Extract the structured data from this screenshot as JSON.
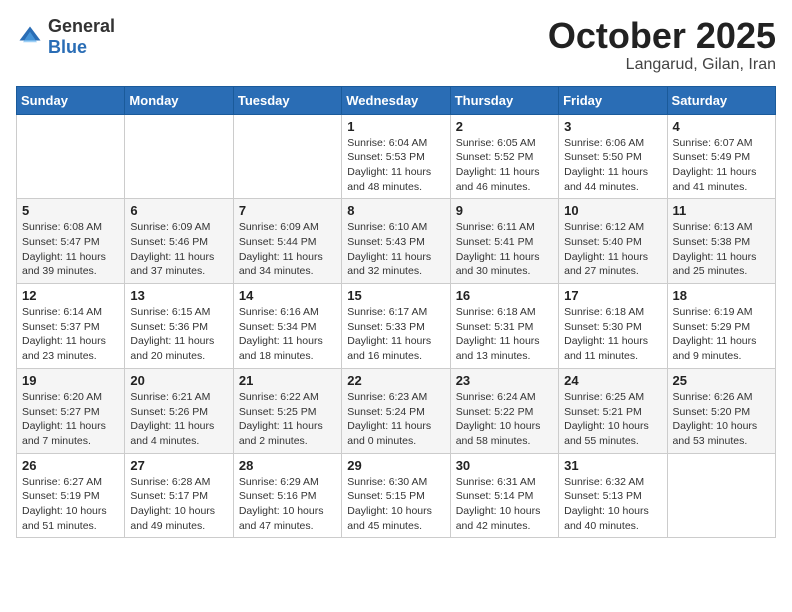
{
  "header": {
    "logo_general": "General",
    "logo_blue": "Blue",
    "month": "October 2025",
    "location": "Langarud, Gilan, Iran"
  },
  "weekdays": [
    "Sunday",
    "Monday",
    "Tuesday",
    "Wednesday",
    "Thursday",
    "Friday",
    "Saturday"
  ],
  "rows": [
    [
      {
        "day": "",
        "sunrise": "",
        "sunset": "",
        "daylight": ""
      },
      {
        "day": "",
        "sunrise": "",
        "sunset": "",
        "daylight": ""
      },
      {
        "day": "",
        "sunrise": "",
        "sunset": "",
        "daylight": ""
      },
      {
        "day": "1",
        "sunrise": "Sunrise: 6:04 AM",
        "sunset": "Sunset: 5:53 PM",
        "daylight": "Daylight: 11 hours and 48 minutes."
      },
      {
        "day": "2",
        "sunrise": "Sunrise: 6:05 AM",
        "sunset": "Sunset: 5:52 PM",
        "daylight": "Daylight: 11 hours and 46 minutes."
      },
      {
        "day": "3",
        "sunrise": "Sunrise: 6:06 AM",
        "sunset": "Sunset: 5:50 PM",
        "daylight": "Daylight: 11 hours and 44 minutes."
      },
      {
        "day": "4",
        "sunrise": "Sunrise: 6:07 AM",
        "sunset": "Sunset: 5:49 PM",
        "daylight": "Daylight: 11 hours and 41 minutes."
      }
    ],
    [
      {
        "day": "5",
        "sunrise": "Sunrise: 6:08 AM",
        "sunset": "Sunset: 5:47 PM",
        "daylight": "Daylight: 11 hours and 39 minutes."
      },
      {
        "day": "6",
        "sunrise": "Sunrise: 6:09 AM",
        "sunset": "Sunset: 5:46 PM",
        "daylight": "Daylight: 11 hours and 37 minutes."
      },
      {
        "day": "7",
        "sunrise": "Sunrise: 6:09 AM",
        "sunset": "Sunset: 5:44 PM",
        "daylight": "Daylight: 11 hours and 34 minutes."
      },
      {
        "day": "8",
        "sunrise": "Sunrise: 6:10 AM",
        "sunset": "Sunset: 5:43 PM",
        "daylight": "Daylight: 11 hours and 32 minutes."
      },
      {
        "day": "9",
        "sunrise": "Sunrise: 6:11 AM",
        "sunset": "Sunset: 5:41 PM",
        "daylight": "Daylight: 11 hours and 30 minutes."
      },
      {
        "day": "10",
        "sunrise": "Sunrise: 6:12 AM",
        "sunset": "Sunset: 5:40 PM",
        "daylight": "Daylight: 11 hours and 27 minutes."
      },
      {
        "day": "11",
        "sunrise": "Sunrise: 6:13 AM",
        "sunset": "Sunset: 5:38 PM",
        "daylight": "Daylight: 11 hours and 25 minutes."
      }
    ],
    [
      {
        "day": "12",
        "sunrise": "Sunrise: 6:14 AM",
        "sunset": "Sunset: 5:37 PM",
        "daylight": "Daylight: 11 hours and 23 minutes."
      },
      {
        "day": "13",
        "sunrise": "Sunrise: 6:15 AM",
        "sunset": "Sunset: 5:36 PM",
        "daylight": "Daylight: 11 hours and 20 minutes."
      },
      {
        "day": "14",
        "sunrise": "Sunrise: 6:16 AM",
        "sunset": "Sunset: 5:34 PM",
        "daylight": "Daylight: 11 hours and 18 minutes."
      },
      {
        "day": "15",
        "sunrise": "Sunrise: 6:17 AM",
        "sunset": "Sunset: 5:33 PM",
        "daylight": "Daylight: 11 hours and 16 minutes."
      },
      {
        "day": "16",
        "sunrise": "Sunrise: 6:18 AM",
        "sunset": "Sunset: 5:31 PM",
        "daylight": "Daylight: 11 hours and 13 minutes."
      },
      {
        "day": "17",
        "sunrise": "Sunrise: 6:18 AM",
        "sunset": "Sunset: 5:30 PM",
        "daylight": "Daylight: 11 hours and 11 minutes."
      },
      {
        "day": "18",
        "sunrise": "Sunrise: 6:19 AM",
        "sunset": "Sunset: 5:29 PM",
        "daylight": "Daylight: 11 hours and 9 minutes."
      }
    ],
    [
      {
        "day": "19",
        "sunrise": "Sunrise: 6:20 AM",
        "sunset": "Sunset: 5:27 PM",
        "daylight": "Daylight: 11 hours and 7 minutes."
      },
      {
        "day": "20",
        "sunrise": "Sunrise: 6:21 AM",
        "sunset": "Sunset: 5:26 PM",
        "daylight": "Daylight: 11 hours and 4 minutes."
      },
      {
        "day": "21",
        "sunrise": "Sunrise: 6:22 AM",
        "sunset": "Sunset: 5:25 PM",
        "daylight": "Daylight: 11 hours and 2 minutes."
      },
      {
        "day": "22",
        "sunrise": "Sunrise: 6:23 AM",
        "sunset": "Sunset: 5:24 PM",
        "daylight": "Daylight: 11 hours and 0 minutes."
      },
      {
        "day": "23",
        "sunrise": "Sunrise: 6:24 AM",
        "sunset": "Sunset: 5:22 PM",
        "daylight": "Daylight: 10 hours and 58 minutes."
      },
      {
        "day": "24",
        "sunrise": "Sunrise: 6:25 AM",
        "sunset": "Sunset: 5:21 PM",
        "daylight": "Daylight: 10 hours and 55 minutes."
      },
      {
        "day": "25",
        "sunrise": "Sunrise: 6:26 AM",
        "sunset": "Sunset: 5:20 PM",
        "daylight": "Daylight: 10 hours and 53 minutes."
      }
    ],
    [
      {
        "day": "26",
        "sunrise": "Sunrise: 6:27 AM",
        "sunset": "Sunset: 5:19 PM",
        "daylight": "Daylight: 10 hours and 51 minutes."
      },
      {
        "day": "27",
        "sunrise": "Sunrise: 6:28 AM",
        "sunset": "Sunset: 5:17 PM",
        "daylight": "Daylight: 10 hours and 49 minutes."
      },
      {
        "day": "28",
        "sunrise": "Sunrise: 6:29 AM",
        "sunset": "Sunset: 5:16 PM",
        "daylight": "Daylight: 10 hours and 47 minutes."
      },
      {
        "day": "29",
        "sunrise": "Sunrise: 6:30 AM",
        "sunset": "Sunset: 5:15 PM",
        "daylight": "Daylight: 10 hours and 45 minutes."
      },
      {
        "day": "30",
        "sunrise": "Sunrise: 6:31 AM",
        "sunset": "Sunset: 5:14 PM",
        "daylight": "Daylight: 10 hours and 42 minutes."
      },
      {
        "day": "31",
        "sunrise": "Sunrise: 6:32 AM",
        "sunset": "Sunset: 5:13 PM",
        "daylight": "Daylight: 10 hours and 40 minutes."
      },
      {
        "day": "",
        "sunrise": "",
        "sunset": "",
        "daylight": ""
      }
    ]
  ]
}
